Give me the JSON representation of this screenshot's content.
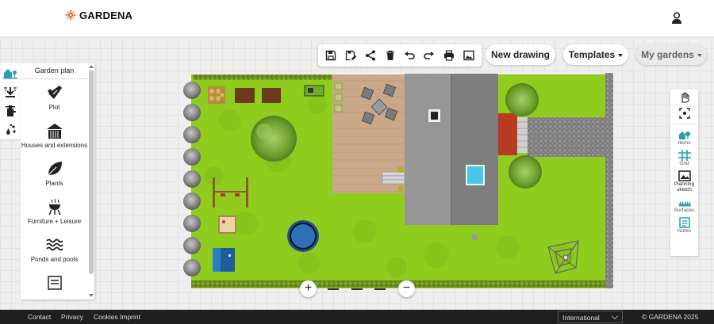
{
  "brand": {
    "name": "GARDENA",
    "accent": "#e8541b"
  },
  "header": {
    "user_icon": "user-icon"
  },
  "toolbar": {
    "buttons": [
      "save-icon",
      "save-as-icon",
      "share-icon",
      "delete-icon",
      "undo-icon",
      "redo-icon",
      "print-icon",
      "image-icon"
    ],
    "new_drawing": "New drawing",
    "templates": "Templates",
    "my_gardens": "My gardens"
  },
  "left_panel": {
    "title": "Garden plan",
    "categories": [
      {
        "label": "Plot",
        "icon": "trowel-icon"
      },
      {
        "label": "Houses and extensions",
        "icon": "house-icon"
      },
      {
        "label": "Plants",
        "icon": "leaf-icon"
      },
      {
        "label": "Furniture + Leisure",
        "icon": "grill-icon"
      },
      {
        "label": "Ponds and pools",
        "icon": "water-icon"
      }
    ],
    "rail_icons": [
      "garden-plan-icon",
      "irrigation-icon",
      "tap-icon",
      "sprinkler-drops-icon"
    ]
  },
  "right_panel": {
    "items": [
      {
        "label": "",
        "icon": "hand-icon"
      },
      {
        "label": "",
        "icon": "focus-icon"
      },
      {
        "label": "Items",
        "icon": "items-icon"
      },
      {
        "label": "Grid",
        "icon": "grid-icon"
      },
      {
        "label": "Planning sketch",
        "icon": "sketch-icon"
      },
      {
        "label": "Surfaces",
        "icon": "surfaces-icon"
      },
      {
        "label": "Notes",
        "icon": "notes-icon"
      }
    ]
  },
  "zoom": {
    "in": "+",
    "out": "−"
  },
  "footer": {
    "links": [
      "Contact",
      "Privacy",
      "Cookies",
      "Imprint"
    ],
    "language": "International",
    "copyright": "© GARDENA 2025"
  },
  "colors": {
    "lawn": "#8fcc1e",
    "deck": "#c9a98a",
    "roof": "#8a8a8a",
    "footer": "#1f1f1f"
  }
}
